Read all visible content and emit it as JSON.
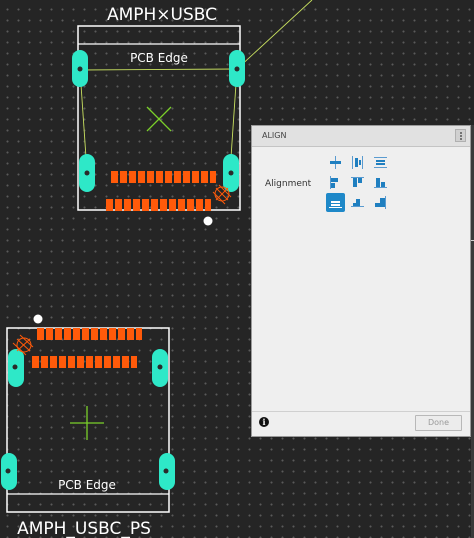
{
  "component_top": {
    "name_label": "AMPH×USBC",
    "edge_label": "PCB Edge"
  },
  "component_bottom": {
    "name_label": "AMPH_USBC_PS",
    "edge_label": "PCB Edge"
  },
  "align_panel": {
    "title": "ALIGN",
    "row_label": "Alignment",
    "buttons": [
      {
        "icon": "align-horizontal-center-icon",
        "selected": false
      },
      {
        "icon": "align-vertical-center-icon",
        "selected": false
      },
      {
        "icon": "distribute-vertical-icon",
        "selected": false
      },
      {
        "icon": "align-left-icon",
        "selected": false
      },
      {
        "icon": "align-top-icon",
        "selected": false
      },
      {
        "icon": "align-right-icon",
        "selected": false
      },
      {
        "icon": "align-bottom-icon",
        "selected": true
      },
      {
        "icon": "center-horizontal-icon",
        "selected": false
      },
      {
        "icon": "align-bottom-right-icon",
        "selected": false
      }
    ],
    "info_icon": "i",
    "done_label": "Done"
  },
  "colors": {
    "pad_copper": "#ff5a0a",
    "mount_pad": "#2ee8c8",
    "outline": "#ffffff",
    "centroid": "#7ad02a",
    "ratsnest": "#c8e060",
    "accent": "#1e88c8"
  }
}
